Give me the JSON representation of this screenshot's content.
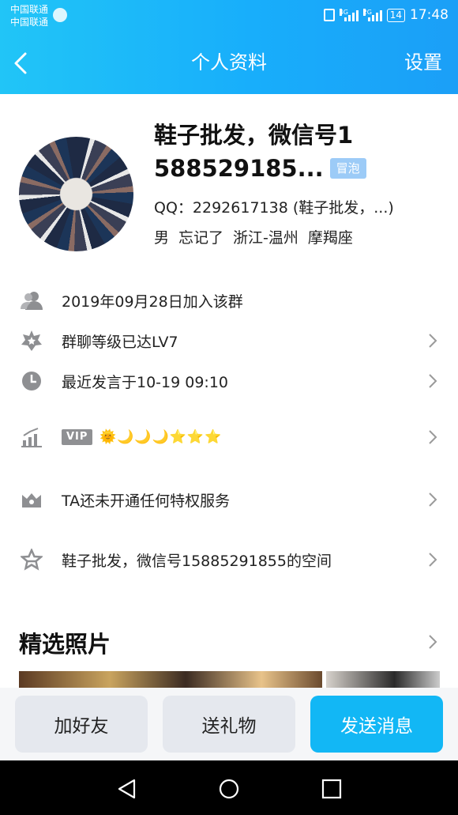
{
  "status_bar": {
    "carrier_1": "中国联通",
    "carrier_2": "中国联通",
    "signal_1_tag": "4G",
    "signal_2_tag": "2G",
    "battery": "14",
    "time": "17:48"
  },
  "header": {
    "title": "个人资料",
    "settings_label": "设置"
  },
  "profile": {
    "nickname_line1": "鞋子批发，微信号1",
    "nickname_line2": "588529185...",
    "bubble_label": "冒泡",
    "qq": "QQ：2292617138 (鞋子批发，...)",
    "gender": "男",
    "age": "忘记了",
    "location": "浙江-温州",
    "zodiac": "摩羯座"
  },
  "info_rows": {
    "joined": "2019年09月28日加入该群",
    "group_level": "群聊等级已达LV7",
    "last_message": "最近发言于10-19 09:10",
    "vip_tag": "VIP",
    "vip_level_icons": "🌞🌙🌙🌙⭐⭐⭐",
    "privilege": "TA还未开通任何特权服务",
    "space": "鞋子批发，微信号15885291855的空间"
  },
  "photos": {
    "section_title": "精选照片"
  },
  "actions": {
    "add_friend": "加好友",
    "send_gift": "送礼物",
    "send_message": "发送消息"
  },
  "colors": {
    "header_gradient_start": "#21c5f7",
    "header_gradient_end": "#1b9ff7",
    "primary_button": "#12b7f5",
    "bubble_tag": "#9ccbf7"
  }
}
